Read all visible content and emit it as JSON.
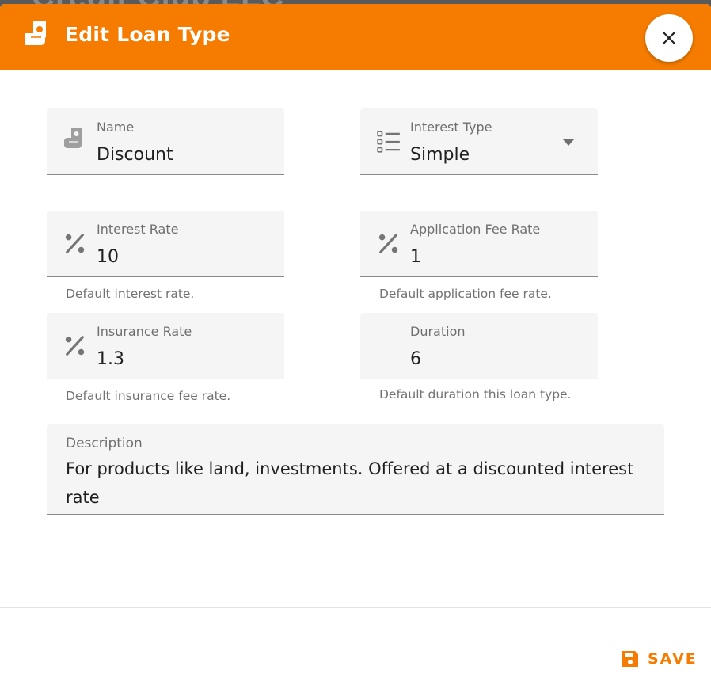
{
  "backdrop": {
    "text": "Credit Club LLC"
  },
  "dialog": {
    "title": "Edit Loan Type",
    "close_icon": "close-icon",
    "header_icon": "hand-money-icon",
    "accent": "#f57c00"
  },
  "fields": {
    "name": {
      "label": "Name",
      "value": "Discount",
      "icon": "hand-money-icon"
    },
    "interest_type": {
      "label": "Interest Type",
      "value": "Simple",
      "icon": "list-icon"
    },
    "interest_rate": {
      "label": "Interest Rate",
      "value": "10",
      "hint": "Default interest rate.",
      "icon": "percent-icon"
    },
    "application_fee_rate": {
      "label": "Application Fee Rate",
      "value": "1",
      "hint": "Default application fee rate.",
      "icon": "percent-icon"
    },
    "insurance_rate": {
      "label": "Insurance Rate",
      "value": "1.3",
      "hint": "Default insurance fee rate.",
      "icon": "percent-icon"
    },
    "duration": {
      "label": "Duration",
      "value": "6",
      "hint": "Default duration this loan type."
    },
    "description": {
      "label": "Description",
      "value": "For products like land, investments. Offered at a discounted interest rate"
    }
  },
  "footer": {
    "save_label": "SAVE",
    "save_icon": "floppy-disk-icon"
  }
}
